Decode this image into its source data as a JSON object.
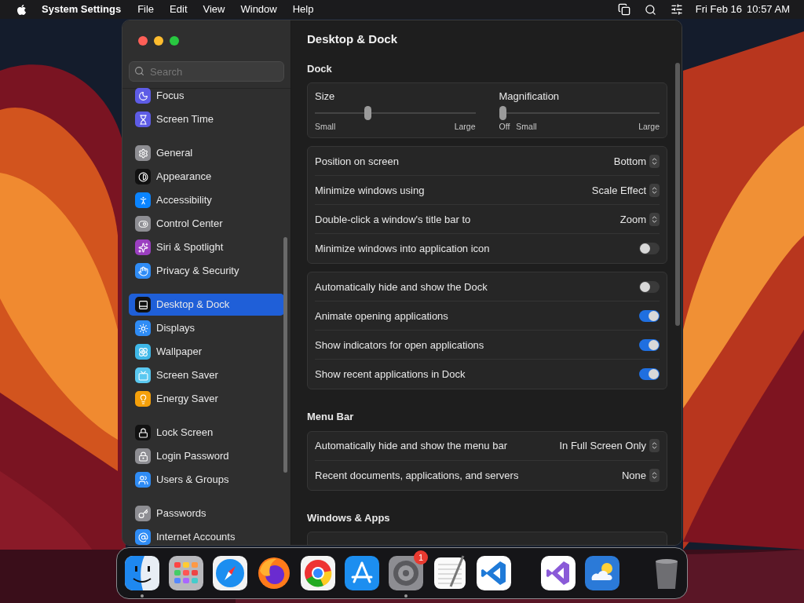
{
  "menu_bar": {
    "app": "System Settings",
    "menus": [
      "File",
      "Edit",
      "View",
      "Window",
      "Help"
    ],
    "date": "Fri Feb 16",
    "time": "10:57 AM"
  },
  "sidebar": {
    "search": {
      "placeholder": "Search"
    },
    "groups": [
      [
        {
          "label": "Focus",
          "color": "#5e5ce6",
          "selected": false
        },
        {
          "label": "Screen Time",
          "color": "#5e5ce6",
          "selected": false
        }
      ],
      [
        {
          "label": "General",
          "color": "#8e8e93",
          "selected": false
        },
        {
          "label": "Appearance",
          "color": "#111111",
          "selected": false
        },
        {
          "label": "Accessibility",
          "color": "#0a84ff",
          "selected": false
        },
        {
          "label": "Control Center",
          "color": "#8e8e93",
          "selected": false
        },
        {
          "label": "Siri & Spotlight",
          "color": "#9b3fc0",
          "selected": false
        },
        {
          "label": "Privacy & Security",
          "color": "#2f8cf5",
          "selected": false
        }
      ],
      [
        {
          "label": "Desktop & Dock",
          "color": "#111111",
          "selected": true
        },
        {
          "label": "Displays",
          "color": "#2f8cf5",
          "selected": false
        },
        {
          "label": "Wallpaper",
          "color": "#3fb8e8",
          "selected": false
        },
        {
          "label": "Screen Saver",
          "color": "#5ac8f0",
          "selected": false
        },
        {
          "label": "Energy Saver",
          "color": "#f5a00a",
          "selected": false
        }
      ],
      [
        {
          "label": "Lock Screen",
          "color": "#111111",
          "selected": false
        },
        {
          "label": "Login Password",
          "color": "#8e8e93",
          "selected": false
        },
        {
          "label": "Users & Groups",
          "color": "#2f8cf5",
          "selected": false
        }
      ],
      [
        {
          "label": "Passwords",
          "color": "#8e8e93",
          "selected": false
        },
        {
          "label": "Internet Accounts",
          "color": "#2f8cf5",
          "selected": false
        }
      ]
    ]
  },
  "page": {
    "title": "Desktop & Dock",
    "sections": [
      {
        "heading": "Dock",
        "cards": [
          {
            "kind": "sliders",
            "sliders": [
              {
                "label": "Size",
                "level": 0.32,
                "marks": [
                  "Small",
                  "Large"
                ]
              },
              {
                "label": "Magnification",
                "level": 0,
                "marks": [
                  "Off",
                  "Small",
                  "Large"
                ]
              }
            ]
          },
          {
            "kind": "rows",
            "rows": [
              {
                "kind": "popup",
                "label": "Position on screen",
                "value": "Bottom"
              },
              {
                "kind": "popup",
                "label": "Minimize windows using",
                "value": "Scale Effect"
              },
              {
                "kind": "popup",
                "label": "Double-click a window's title bar to",
                "value": "Zoom"
              },
              {
                "kind": "toggle",
                "label": "Minimize windows into application icon",
                "on": false
              }
            ]
          },
          {
            "kind": "rows",
            "rows": [
              {
                "kind": "toggle",
                "label": "Automatically hide and show the Dock",
                "on": false
              },
              {
                "kind": "toggle",
                "label": "Animate opening applications",
                "on": true
              },
              {
                "kind": "toggle",
                "label": "Show indicators for open applications",
                "on": true
              },
              {
                "kind": "toggle",
                "label": "Show recent applications in Dock",
                "on": true
              }
            ]
          }
        ]
      },
      {
        "heading": "Menu Bar",
        "cards": [
          {
            "kind": "rows",
            "rows": [
              {
                "kind": "popup",
                "label": "Automatically hide and show the menu bar",
                "value": "In Full Screen Only"
              },
              {
                "kind": "popup",
                "label": "Recent documents, applications, and servers",
                "value": "None"
              }
            ]
          }
        ]
      },
      {
        "heading": "Windows & Apps",
        "cards": [
          {
            "kind": "rows"
          }
        ]
      }
    ]
  },
  "dock": {
    "groups": [
      [
        {
          "running": true
        },
        {
          "running": false
        },
        {
          "running": false
        },
        {
          "running": false
        },
        {
          "running": false
        },
        {
          "running": false
        },
        {
          "running": true,
          "badge": "1"
        },
        {
          "running": false
        },
        {
          "running": false
        }
      ],
      [
        {
          "running": false
        },
        {
          "running": false
        }
      ],
      [
        {
          "running": false
        }
      ]
    ]
  }
}
